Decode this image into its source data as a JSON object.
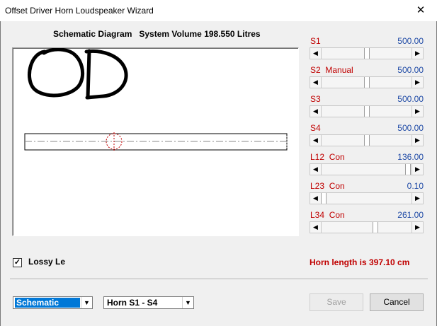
{
  "window": {
    "title": "Offset Driver Horn Loudspeaker Wizard",
    "close_glyph": "✕"
  },
  "schematic": {
    "heading": "Schematic Diagram   System Volume 198.550 Litres",
    "logo_text": "OD"
  },
  "sliders": [
    {
      "label": "S1",
      "value": "500.00",
      "position": 0.5
    },
    {
      "label": "S2  Manual",
      "value": "500.00",
      "position": 0.5
    },
    {
      "label": "S3",
      "value": "500.00",
      "position": 0.5
    },
    {
      "label": "S4",
      "value": "500.00",
      "position": 0.5
    },
    {
      "label": "L12  Con",
      "value": "136.00",
      "position": 0.985
    },
    {
      "label": "L23  Con",
      "value": "0.10",
      "position": 0.0
    },
    {
      "label": "L34  Con",
      "value": "261.00",
      "position": 0.6
    }
  ],
  "lossy": {
    "label": "Lossy Le",
    "checked": true,
    "check_glyph": "✓"
  },
  "horn_length": "Horn length is 397.10 cm",
  "view_select": {
    "value": "Schematic"
  },
  "section_select": {
    "value": "Horn S1 - S4"
  },
  "buttons": {
    "save": "Save",
    "cancel": "Cancel"
  },
  "icons": {
    "left_arrow": "◀",
    "right_arrow": "▶",
    "dropdown": "▼"
  },
  "colors": {
    "label_red": "#c00000",
    "value_blue": "#1f4aa6",
    "selection": "#0078d7"
  }
}
